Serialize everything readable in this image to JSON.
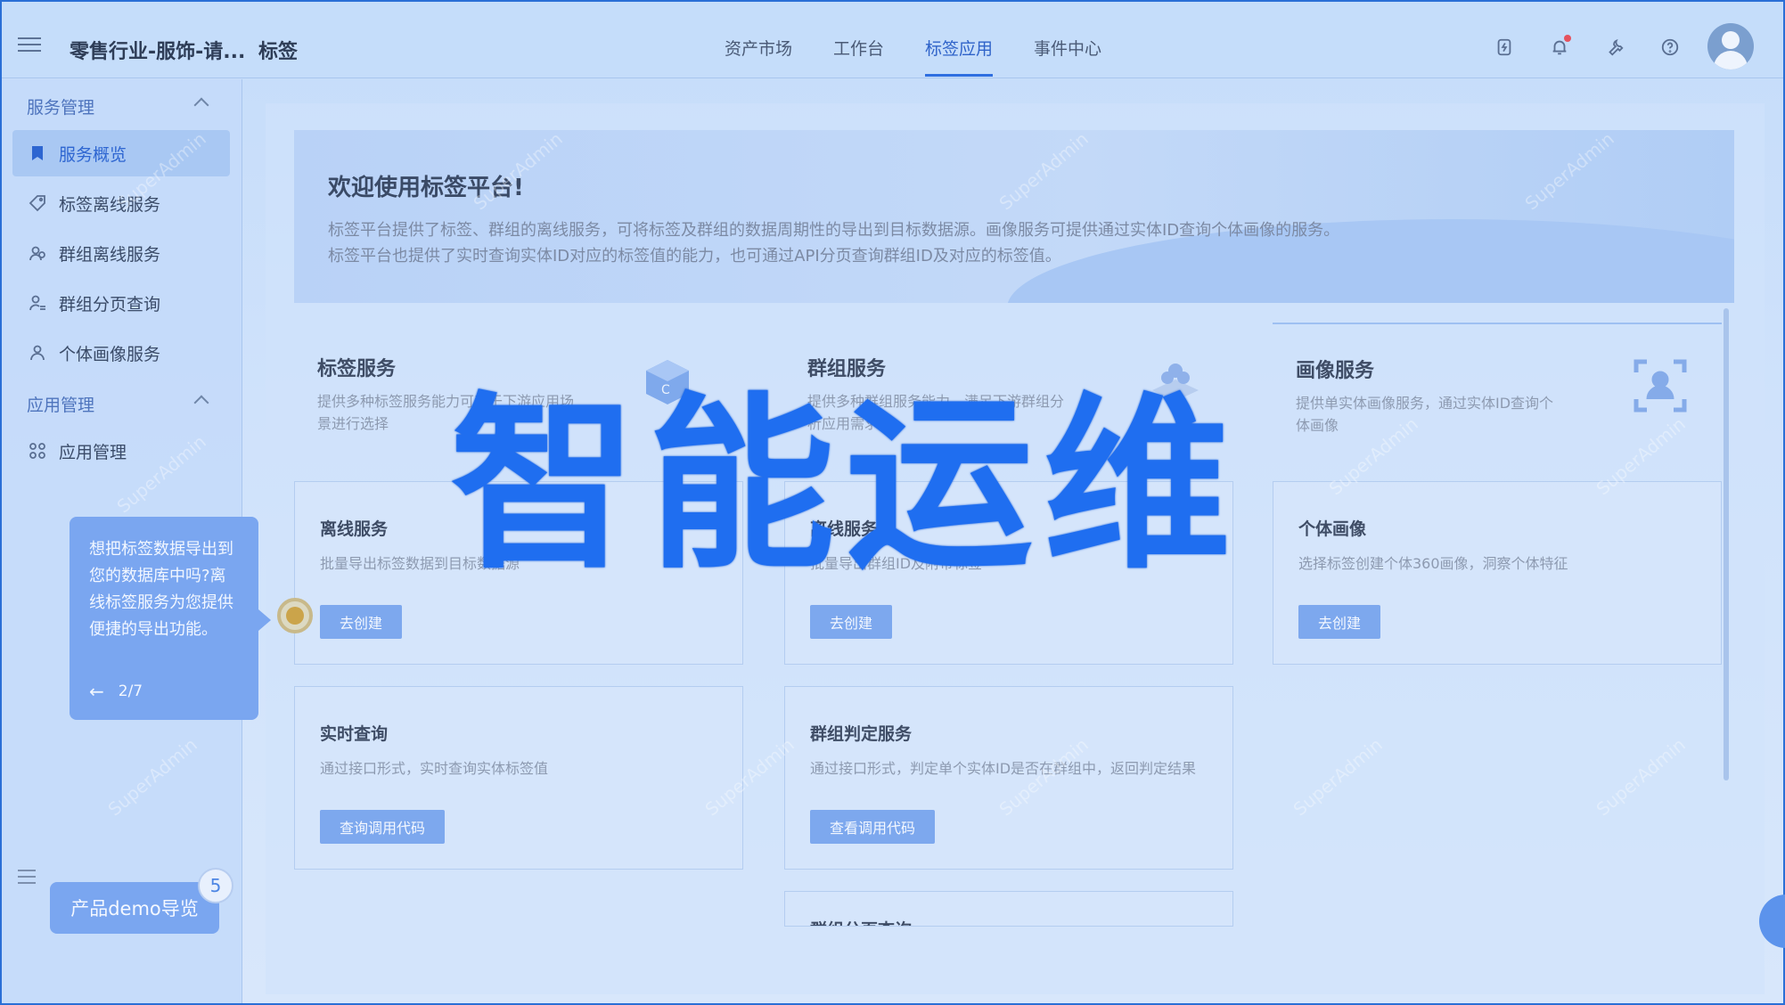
{
  "header": {
    "app_title": "零售行业-服饰-请...",
    "app_subtitle": "标签",
    "nav": [
      {
        "label": "资产市场",
        "active": false
      },
      {
        "label": "工作台",
        "active": false
      },
      {
        "label": "标签应用",
        "active": true
      },
      {
        "label": "事件中心",
        "active": false
      }
    ],
    "icons": [
      "flash-icon",
      "bell-icon",
      "wrench-icon",
      "help-icon"
    ],
    "notification_dot": true
  },
  "sidebar": {
    "groups": [
      {
        "label": "服务管理",
        "items": [
          {
            "label": "服务概览",
            "icon": "bookmark-icon",
            "active": true
          },
          {
            "label": "标签离线服务",
            "icon": "tag-icon",
            "active": false
          },
          {
            "label": "群组离线服务",
            "icon": "group-icon",
            "active": false
          },
          {
            "label": "群组分页查询",
            "icon": "group-search-icon",
            "active": false
          },
          {
            "label": "个体画像服务",
            "icon": "user-icon",
            "active": false
          }
        ]
      },
      {
        "label": "应用管理",
        "items": [
          {
            "label": "应用管理",
            "icon": "apps-icon",
            "active": false
          }
        ]
      }
    ]
  },
  "tour": {
    "text": "想把标签数据导出到您的数据库中吗?离线标签服务为您提供便捷的导出功能。",
    "step": "2/7"
  },
  "demo": {
    "label": "产品demo导览",
    "badge": "5"
  },
  "welcome": {
    "title": "欢迎使用标签平台!",
    "line1": "标签平台提供了标签、群组的离线服务，可将标签及群组的数据周期性的导出到目标数据源。画像服务可提供通过实体ID查询个体画像的服务。",
    "line2": "标签平台也提供了实时查询实体ID对应的标签值的能力，也可通过API分页查询群组ID及对应的标签值。"
  },
  "services": [
    {
      "title": "标签服务",
      "desc": "提供多种标签服务能力可基于下游应用场景进行选择"
    },
    {
      "title": "群组服务",
      "desc": "提供多种群组服务能力，满足下游群组分析应用需求"
    },
    {
      "title": "画像服务",
      "desc": "提供单实体画像服务，通过实体ID查询个体画像"
    }
  ],
  "features": [
    {
      "title": "离线服务",
      "desc": "批量导出标签数据到目标数据源",
      "button": "去创建"
    },
    {
      "title": "离线服务",
      "desc": "批量导出群组ID及附带标签",
      "button": "去创建"
    },
    {
      "title": "个体画像",
      "desc": "选择标签创建个体360画像，洞察个体特征",
      "button": "去创建"
    },
    {
      "title": "实时查询",
      "desc": "通过接口形式，实时查询实体标签值",
      "button": "查询调用代码"
    },
    {
      "title": "群组判定服务",
      "desc": "通过接口形式，判定单个实体ID是否在群组中，返回判定结果",
      "button": "查看调用代码"
    },
    {
      "title": "群组分页查询",
      "desc": "",
      "button": ""
    }
  ],
  "watermark": "SuperAdmin",
  "banner": "智能运维"
}
